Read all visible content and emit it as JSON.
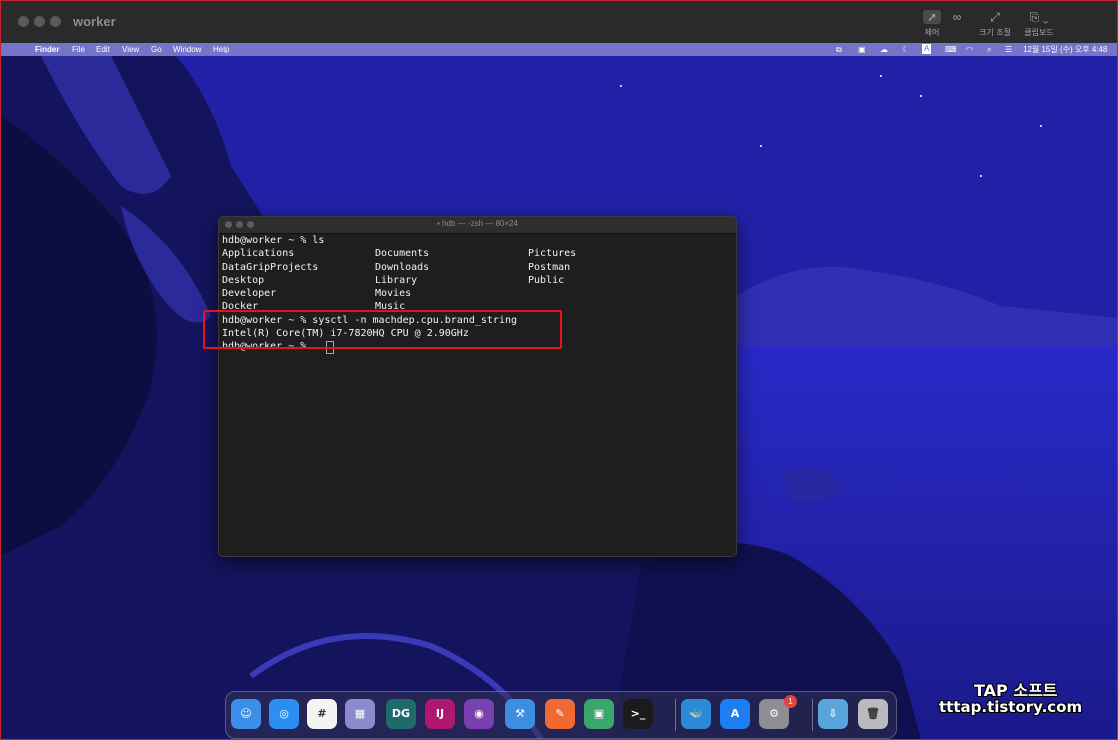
{
  "outer_window": {
    "title": "worker",
    "toolbar": [
      {
        "name": "control",
        "label": "제어",
        "icon": "pointer-icon"
      },
      {
        "name": "scale",
        "label": "크기 조절",
        "icon": "resize-icon"
      },
      {
        "name": "clipboard",
        "label": "클립보드",
        "icon": "clipboard-icon"
      }
    ]
  },
  "menubar": {
    "app": "Finder",
    "items": [
      "File",
      "Edit",
      "View",
      "Go",
      "Window",
      "Help"
    ],
    "clock": "12월 15일 (수) 오후 4:48",
    "input_indicator": "A"
  },
  "terminal": {
    "title": "hdb — -zsh — 80×24",
    "lines": [
      {
        "cols": [
          "hdb@worker ~ % ls"
        ]
      },
      {
        "cols": [
          "Applications",
          "Documents",
          "Pictures"
        ]
      },
      {
        "cols": [
          "DataGripProjects",
          "Downloads",
          "Postman"
        ]
      },
      {
        "cols": [
          "Desktop",
          "Library",
          "Public"
        ]
      },
      {
        "cols": [
          "Developer",
          "Movies",
          ""
        ]
      },
      {
        "cols": [
          "Docker",
          "Music",
          ""
        ]
      },
      {
        "cols": [
          "hdb@worker ~ % sysctl -n machdep.cpu.brand_string"
        ]
      },
      {
        "cols": [
          "Intel(R) Core(TM) i7-7820HQ CPU @ 2.90GHz"
        ]
      },
      {
        "cols": [
          "hdb@worker ~ % "
        ]
      }
    ]
  },
  "dock": {
    "items": [
      {
        "name": "Finder",
        "icon": "finder-icon",
        "glyph": "☺",
        "color": "#3b8fe8"
      },
      {
        "name": "Safari",
        "icon": "safari-icon",
        "glyph": "◎",
        "color": "#2c8df2"
      },
      {
        "name": "Slack",
        "icon": "slack-icon",
        "glyph": "#",
        "color": "#f4f4f4"
      },
      {
        "name": "Launchpad",
        "icon": "launchpad-icon",
        "glyph": "▦",
        "color": "#8a8acd"
      },
      {
        "name": "DataGrip",
        "icon": "datagrip-icon",
        "glyph": "DG",
        "color": "#1f6b6b"
      },
      {
        "name": "IntelliJ IDEA",
        "icon": "intellij-icon",
        "glyph": "IJ",
        "color": "#b01870"
      },
      {
        "name": "GitHub Desktop",
        "icon": "github-icon",
        "glyph": "◉",
        "color": "#7a3fb0"
      },
      {
        "name": "Xcode",
        "icon": "xcode-icon",
        "glyph": "⚒",
        "color": "#3d8ee0"
      },
      {
        "name": "Postman",
        "icon": "postman-icon",
        "glyph": "✎",
        "color": "#ef6a33"
      },
      {
        "name": "Screen Sharing",
        "icon": "screen-sharing-icon",
        "glyph": "▣",
        "color": "#3aa66a"
      },
      {
        "name": "Terminal",
        "icon": "terminal-icon",
        "glyph": ">_",
        "color": "#1b1b1b"
      },
      {
        "name": "Docker",
        "icon": "docker-icon",
        "glyph": "🐳",
        "color": "#2d8ad6"
      },
      {
        "name": "App Store",
        "icon": "app-store-icon",
        "glyph": "A",
        "color": "#1c7ef0"
      },
      {
        "name": "System Preferences",
        "icon": "system-preferences-icon",
        "glyph": "⚙",
        "color": "#8d8d92"
      },
      {
        "name": "Downloads",
        "icon": "downloads-folder-icon",
        "glyph": "⇩",
        "color": "#5aa5dc"
      },
      {
        "name": "Trash",
        "icon": "trash-icon",
        "glyph": "🗑",
        "color": "#b9b9be"
      }
    ],
    "badge": "1"
  },
  "watermark": {
    "line1": "TAP 소프트",
    "line2": "tttap.tistory.com"
  }
}
